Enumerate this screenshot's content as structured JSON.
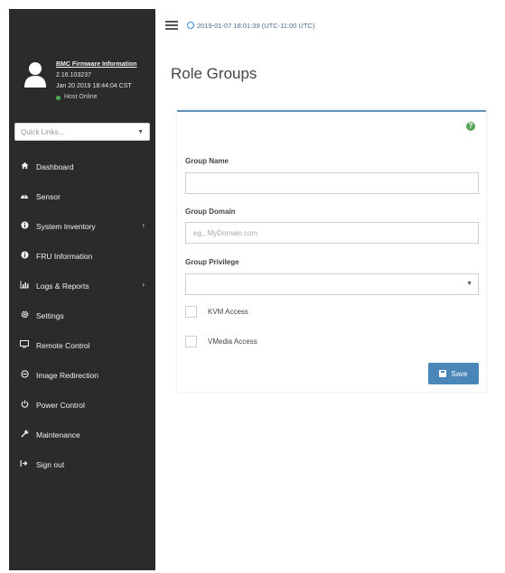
{
  "header": {
    "datetime": "2019-01-07 18:01:39 (UTC-11:00 UTC)"
  },
  "user": {
    "title": "BMC Firmware Information",
    "version": "2.16.103237",
    "build_date": "Jan 20 2019 18:44:04 CST",
    "status": "Host Online"
  },
  "sidebar": {
    "quicklinks_placeholder": "Quick Links...",
    "items": [
      {
        "label": "Dashboard",
        "icon": "dashboard-icon"
      },
      {
        "label": "Sensor",
        "icon": "sensor-icon"
      },
      {
        "label": "System Inventory",
        "icon": "info-icon"
      },
      {
        "label": "FRU Information",
        "icon": "info-icon"
      },
      {
        "label": "Logs & Reports",
        "icon": "bar-chart-icon"
      },
      {
        "label": "Settings",
        "icon": "gear-icon"
      },
      {
        "label": "Remote Control",
        "icon": "monitor-icon"
      },
      {
        "label": "Image Redirection",
        "icon": "disc-icon"
      },
      {
        "label": "Power Control",
        "icon": "power-icon"
      },
      {
        "label": "Maintenance",
        "icon": "wrench-icon"
      },
      {
        "label": "Sign out",
        "icon": "sign-out-icon"
      }
    ]
  },
  "main": {
    "title": "Role Groups",
    "form": {
      "group_name_label": "Group Name",
      "group_name_value": "",
      "group_domain_label": "Group Domain",
      "group_domain_placeholder": "eg., MyDomain.com",
      "group_privilege_label": "Group Privilege",
      "group_privilege_value": "",
      "kvm_label": "KVM Access",
      "vmedia_label": "VMedia Access",
      "save_label": "Save"
    }
  },
  "colors": {
    "sidebar_bg": "#2b2b2b",
    "accent": "#4a86b7",
    "help_icon": "#5aa55a",
    "status_online": "#4caf50"
  }
}
